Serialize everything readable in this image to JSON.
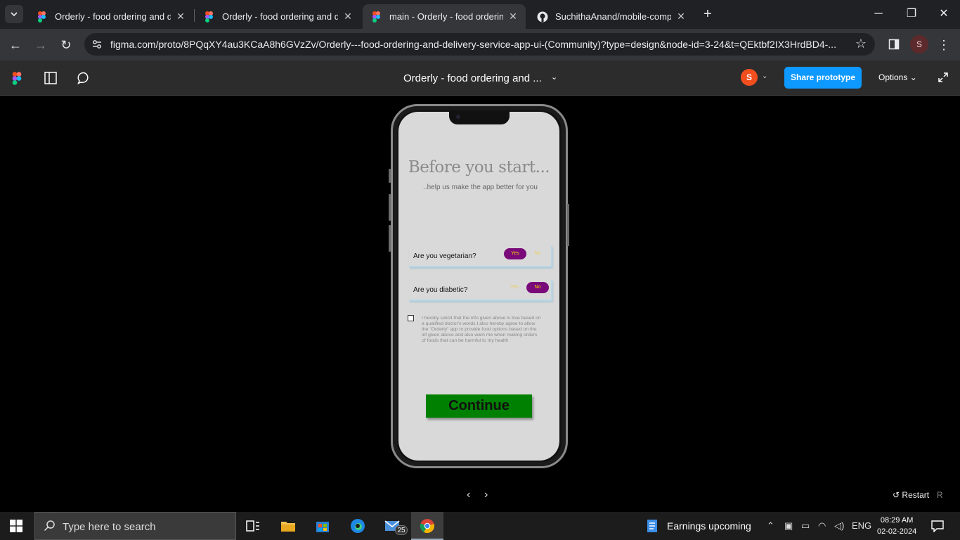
{
  "browser": {
    "tabs": [
      {
        "title": "Orderly - food ordering and deli",
        "icon": "figma-icon",
        "active": false
      },
      {
        "title": "Orderly - food ordering and deli",
        "icon": "figma-icon",
        "active": false
      },
      {
        "title": "main - Orderly - food ordering",
        "icon": "figma-icon",
        "active": true
      },
      {
        "title": "SuchithaAnand/mobile-computi",
        "icon": "github-icon",
        "active": false
      }
    ],
    "url": "figma.com/proto/8PQqXY4au3KCaA8h6GVzZv/Orderly---food-ordering-and-delivery-service-app-ui-(Community)?type=design&node-id=3-24&t=QEktbf2IX3HrdBD4-...",
    "profile_initial": "S"
  },
  "figma": {
    "file_title": "Orderly - food ordering and ...",
    "avatar_initial": "S",
    "share_label": "Share prototype",
    "options_label": "Options",
    "restart_label": "Restart",
    "restart_key": "R"
  },
  "app": {
    "title": "Before you start...",
    "subtitle": "..help us make the app better for you",
    "questions": [
      {
        "label": "Are you vegetarian?",
        "yes": "Yes",
        "no": "No",
        "selected": "Yes"
      },
      {
        "label": "Are you diabetic?",
        "yes": "Yes",
        "no": "No",
        "selected": "No"
      }
    ],
    "consent_text": "I hereby solicit that the info given above is true based on a qualified doctor's words.I also hereby agree to allow the \"Orderly\" app to provide food options based on the inf given above and also warn me when making orders of foods that can be harmful to my health",
    "consent_checked": false,
    "continue_label": "Continue",
    "colors": {
      "pill_active": "#7a0a7a",
      "pill_text": "#f5d000",
      "continue": "#008000"
    }
  },
  "taskbar": {
    "search_placeholder": "Type here to search",
    "mail_badge": "25",
    "news": "Earnings upcoming",
    "language": "ENG",
    "time": "08:29 AM",
    "date": "02-02-2024"
  }
}
